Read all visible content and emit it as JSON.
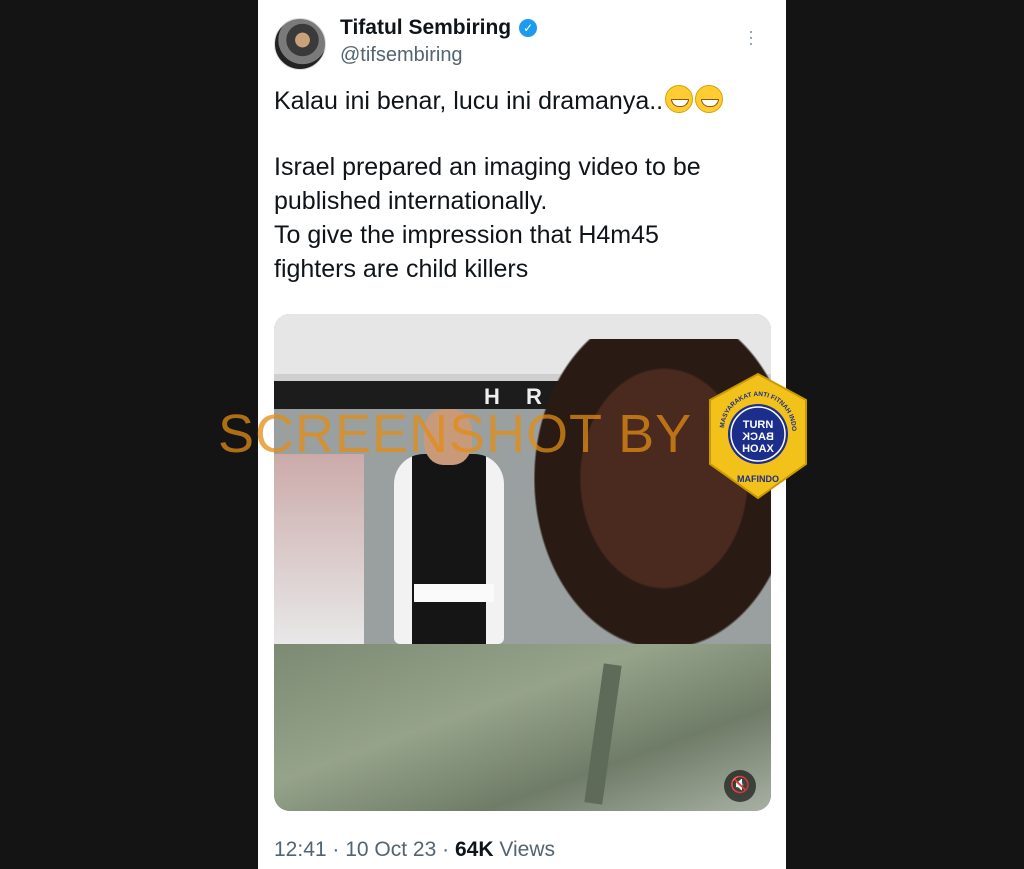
{
  "tweet": {
    "author_name": "Tifatul Sembiring",
    "handle": "@tifsembiring",
    "text_line1": "Kalau ini benar, lucu ini dramanya..",
    "text_para2": [
      "Israel prepared an imaging video to be",
      "published internationally.",
      "To give the impression that H4m45",
      "fighters are child killers"
    ],
    "emoji": [
      "grinning-face",
      "grinning-face"
    ],
    "time": "12:41",
    "date": "10 Oct 23",
    "views_count": "64K",
    "views_label": "Views",
    "video_sign_text": "H R"
  },
  "overlay": {
    "watermark": "SCREENSHOT BY",
    "badge": {
      "arc_text": "MASYARAKAT ANTI FITNAH INDONESIA",
      "line1": "TURN",
      "line2": "BACK",
      "line3": "HOAX",
      "bottom": "MAFINDO"
    }
  },
  "colors": {
    "page_bg": "#141414",
    "card_bg": "#ffffff",
    "verified": "#1d9bf0",
    "watermark": "#e28c14",
    "badge_fill": "#f2c21a",
    "badge_inner": "#1b2e8c"
  }
}
